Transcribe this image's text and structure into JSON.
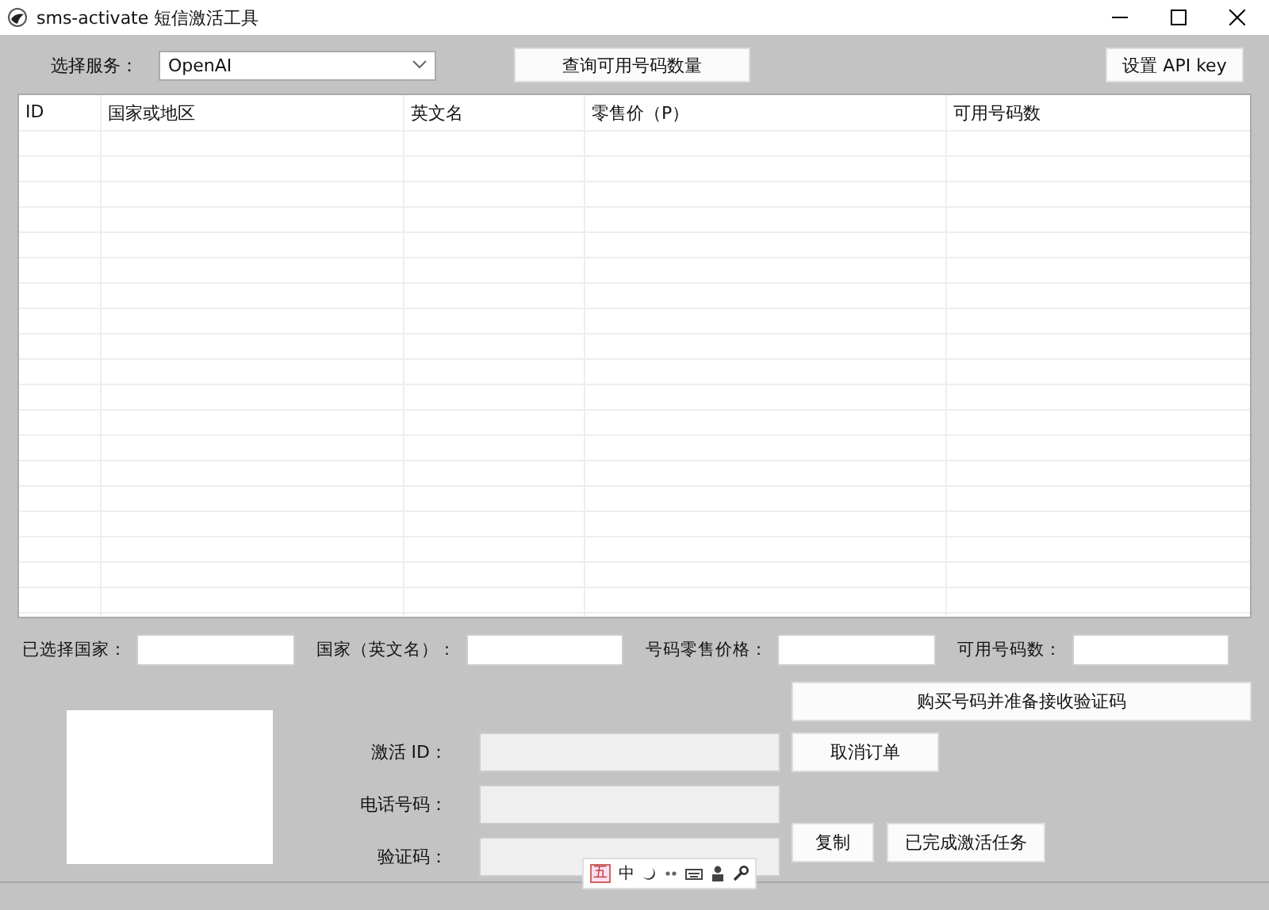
{
  "window": {
    "title": "sms-activate 短信激活工具"
  },
  "service": {
    "label": "选择服务：",
    "value": "OpenAI"
  },
  "query_button": "查询可用号码数量",
  "api_button": "设置 API key",
  "table": {
    "columns": [
      "ID",
      "国家或地区",
      "英文名",
      "零售价（P）",
      "可用号码数"
    ]
  },
  "selection_fields": [
    {
      "label": "已选择国家："
    },
    {
      "label": "国家（英文名）："
    },
    {
      "label": "号码零售价格："
    },
    {
      "label": "可用号码数："
    }
  ],
  "buy_button": "购买号码并准备接收验证码",
  "activation": {
    "id_label": "激活 ID：",
    "phone_label": "电话号码：",
    "code_label": "验证码："
  },
  "cancel_button": "取消订单",
  "copy_button": "复制",
  "done_button": "已完成激活任务",
  "ime_toolbar": {
    "mode": "五",
    "language": "中"
  }
}
